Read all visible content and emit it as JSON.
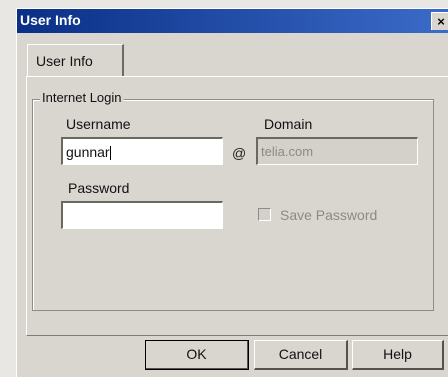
{
  "window": {
    "title": "User Info",
    "close_glyph": "×"
  },
  "tabs": [
    {
      "label": "User Info",
      "active": true
    }
  ],
  "group": {
    "label": "Internet Login",
    "username_label": "Username",
    "username_value": "gunnar",
    "at_symbol": "@",
    "domain_label": "Domain",
    "domain_value": "telia.com",
    "password_label": "Password",
    "password_value": "",
    "save_password_label": "Save Password",
    "save_password_checked": false
  },
  "buttons": {
    "ok": "OK",
    "cancel": "Cancel",
    "help": "Help"
  },
  "colors": {
    "titlebar_start": "#0a2f86",
    "titlebar_end": "#3b6bc8",
    "dialog_bg": "#d9d6d0"
  }
}
